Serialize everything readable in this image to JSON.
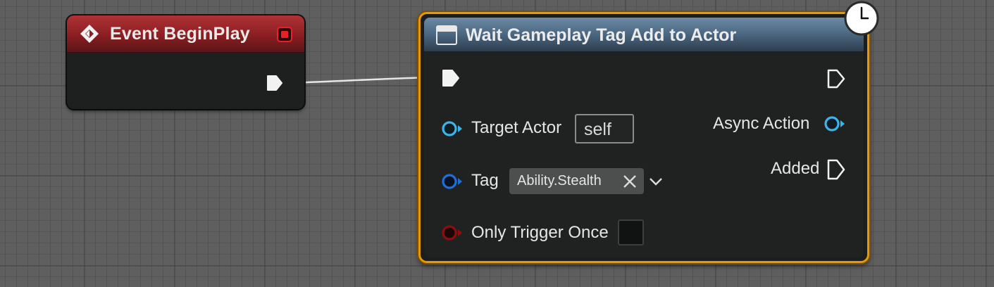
{
  "event_node": {
    "title": "Event BeginPlay",
    "header_color": "#8a1e22",
    "icon": "event-diamond-icon",
    "delegate_pin_color": "#e8202a"
  },
  "async_node": {
    "title": "Wait Gameplay Tag Add to Actor",
    "header_color": "#4a6680",
    "border_color": "#e29a0c",
    "icon": "function-icon",
    "latent_icon": "clock-icon",
    "inputs": {
      "target_actor": {
        "label": "Target Actor",
        "value": "self",
        "pin_color": "#3cb4e8"
      },
      "tag": {
        "label": "Tag",
        "value": "Ability.Stealth",
        "pin_color": "#1f6fd6"
      },
      "only_trigger_once": {
        "label": "Only Trigger Once",
        "checked": false,
        "pin_color": "#8b0f0f"
      }
    },
    "outputs": {
      "async_action": {
        "label": "Async Action",
        "pin_color": "#3cb4e8"
      },
      "added": {
        "label": "Added"
      }
    }
  },
  "colors": {
    "background": "#5f5f5f",
    "exec_wire": "#e6e6e6"
  }
}
